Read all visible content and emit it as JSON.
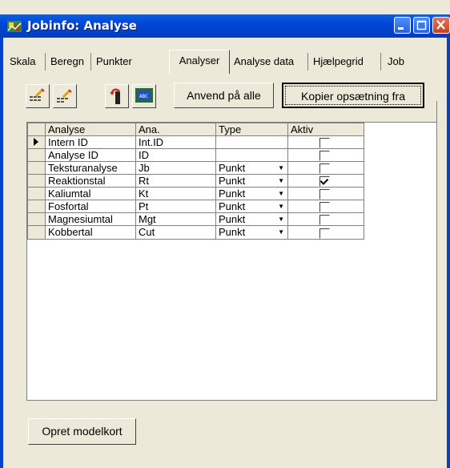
{
  "window": {
    "title": "Jobinfo: Analyse"
  },
  "tabs": [
    {
      "label": "Skala"
    },
    {
      "label": "Beregn"
    },
    {
      "label": "Punkter"
    },
    {
      "label": "Analyser"
    },
    {
      "label": "Analyse data"
    },
    {
      "label": "Hjælpegrid"
    },
    {
      "label": "Job"
    }
  ],
  "toolbar": {
    "apply_all_label": "Anvend på alle",
    "copy_setup_label": "Kopier opsætning fra"
  },
  "grid": {
    "headers": {
      "analyse": "Analyse",
      "ana": "Ana.",
      "type": "Type",
      "aktiv": "Aktiv"
    },
    "rows": [
      {
        "analyse": "Intern ID",
        "ana": "Int.ID",
        "type": "",
        "aktiv": false
      },
      {
        "analyse": "Analyse ID",
        "ana": "ID",
        "type": "",
        "aktiv": false
      },
      {
        "analyse": "Teksturanalyse",
        "ana": "Jb",
        "type": "Punkt",
        "aktiv": false
      },
      {
        "analyse": "Reaktionstal",
        "ana": "Rt",
        "type": "Punkt",
        "aktiv": true
      },
      {
        "analyse": "Kaliumtal",
        "ana": "Kt",
        "type": "Punkt",
        "aktiv": false
      },
      {
        "analyse": "Fosfortal",
        "ana": "Pt",
        "type": "Punkt",
        "aktiv": false
      },
      {
        "analyse": "Magnesiumtal",
        "ana": "Mgt",
        "type": "Punkt",
        "aktiv": false
      },
      {
        "analyse": "Kobbertal",
        "ana": "Cut",
        "type": "Punkt",
        "aktiv": false
      }
    ]
  },
  "footer": {
    "create_model_card_label": "Opret modelkort"
  }
}
